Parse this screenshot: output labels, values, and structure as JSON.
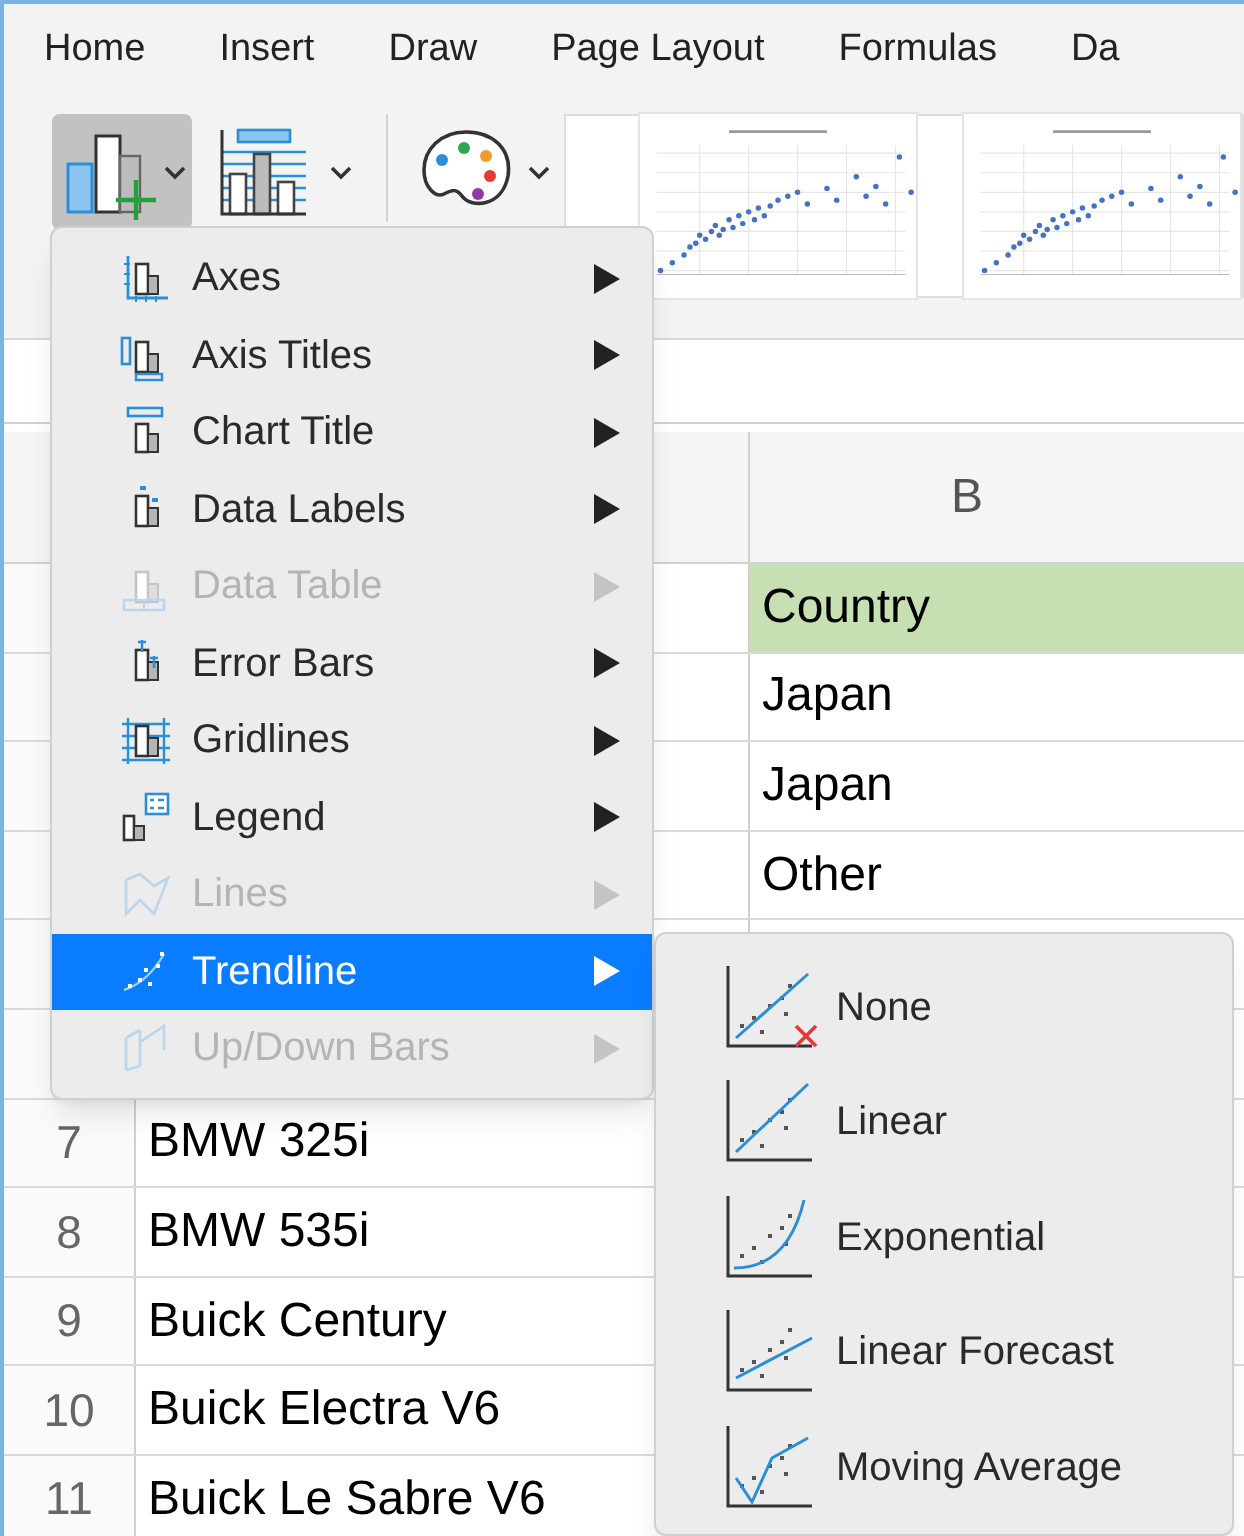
{
  "ribbon_tabs": [
    {
      "label": "Home"
    },
    {
      "label": "Insert"
    },
    {
      "label": "Draw"
    },
    {
      "label": "Page Layout"
    },
    {
      "label": "Formulas"
    },
    {
      "label": "Da"
    }
  ],
  "sheet": {
    "column_header": "B",
    "rows": [
      {
        "col_b": "Country",
        "header": true
      },
      {
        "col_b": "Japan",
        "header": false
      },
      {
        "col_b": "Japan",
        "header": false
      },
      {
        "col_b": "Other",
        "header": false
      },
      {
        "header": false
      },
      {
        "header": false
      },
      {
        "number": "7",
        "col_a": "BMW 325i",
        "header": false
      },
      {
        "number": "8",
        "col_a": "BMW 535i",
        "header": false
      },
      {
        "number": "9",
        "col_a": "Buick Century",
        "header": false
      },
      {
        "number": "10",
        "col_a": "Buick Electra V6",
        "header": false
      },
      {
        "number": "11",
        "col_a": "Buick Le Sabre V6",
        "header": false
      }
    ]
  },
  "chart_element_menu": [
    {
      "label": "Axes",
      "kind": "axes",
      "disabled": false,
      "selected": false
    },
    {
      "label": "Axis Titles",
      "kind": "axis-titles",
      "disabled": false,
      "selected": false
    },
    {
      "label": "Chart Title",
      "kind": "chart-title",
      "disabled": false,
      "selected": false
    },
    {
      "label": "Data Labels",
      "kind": "data-labels",
      "disabled": false,
      "selected": false
    },
    {
      "label": "Data Table",
      "kind": "data-table",
      "disabled": true,
      "selected": false
    },
    {
      "label": "Error Bars",
      "kind": "error-bars",
      "disabled": false,
      "selected": false
    },
    {
      "label": "Gridlines",
      "kind": "gridlines",
      "disabled": false,
      "selected": false
    },
    {
      "label": "Legend",
      "kind": "legend",
      "disabled": false,
      "selected": false
    },
    {
      "label": "Lines",
      "kind": "lines",
      "disabled": true,
      "selected": false
    },
    {
      "label": "Trendline",
      "kind": "trendline",
      "disabled": false,
      "selected": true
    },
    {
      "label": "Up/Down Bars",
      "kind": "updown",
      "disabled": true,
      "selected": false
    }
  ],
  "trendline_menu": [
    {
      "label": "None",
      "kind": "none"
    },
    {
      "label": "Linear",
      "kind": "linear"
    },
    {
      "label": "Exponential",
      "kind": "exponential"
    },
    {
      "label": "Linear Forecast",
      "kind": "forecast"
    },
    {
      "label": "Moving Average",
      "kind": "moving"
    }
  ]
}
